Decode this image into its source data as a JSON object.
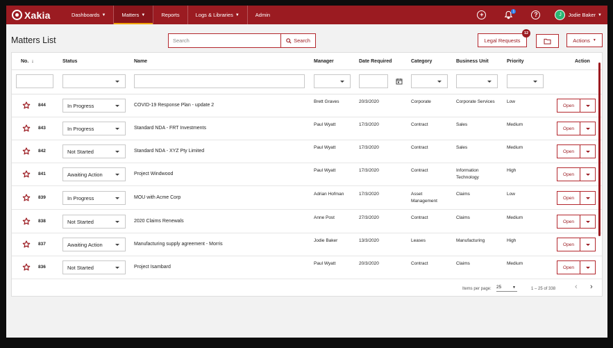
{
  "topbar": {
    "logo_text": "Xakia",
    "nav": [
      {
        "label": "Dashboards",
        "caret": true
      },
      {
        "label": "Matters",
        "caret": true,
        "active": true
      },
      {
        "label": "Reports",
        "caret": false
      },
      {
        "label": "Logs & Libraries",
        "caret": true
      },
      {
        "label": "Admin",
        "caret": false
      }
    ],
    "notification_count": "1",
    "user_initial": "J",
    "user_name": "Jodie Baker"
  },
  "header": {
    "title": "Matters List",
    "search_placeholder": "Search",
    "search_button": "Search",
    "legal_requests_label": "Legal Requests",
    "legal_requests_count": "12",
    "actions_label": "Actions"
  },
  "table": {
    "columns": {
      "no": "No.",
      "status": "Status",
      "name": "Name",
      "manager": "Manager",
      "date": "Date Required",
      "category": "Category",
      "unit": "Business Unit",
      "priority": "Priority",
      "action": "Action"
    },
    "open_label": "Open",
    "rows": [
      {
        "no": "844",
        "status": "In Progress",
        "name": "COVID-19 Response Plan - update 2",
        "manager": "Brett Graves",
        "date": "20/3/2020",
        "category": "Corporate",
        "unit": "Corporate Services",
        "priority": "Low"
      },
      {
        "no": "843",
        "status": "In Progress",
        "name": "Standard NDA - FRT Investments",
        "manager": "Paul Wyatt",
        "date": "17/3/2020",
        "category": "Contract",
        "unit": "Sales",
        "priority": "Medium"
      },
      {
        "no": "842",
        "status": "Not Started",
        "name": "Standard NDA - XYZ Pty Limited",
        "manager": "Paul Wyatt",
        "date": "17/3/2020",
        "category": "Contract",
        "unit": "Sales",
        "priority": "Medium"
      },
      {
        "no": "841",
        "status": "Awaiting Action",
        "name": "Project Windwood",
        "manager": "Paul Wyatt",
        "date": "17/3/2020",
        "category": "Contract",
        "unit": "Information Technology",
        "priority": "High"
      },
      {
        "no": "839",
        "status": "In Progress",
        "name": "MOU with Acme Corp",
        "manager": "Adrian Hofman",
        "date": "17/3/2020",
        "category": "Asset Management",
        "unit": "Claims",
        "priority": "Low"
      },
      {
        "no": "838",
        "status": "Not Started",
        "name": "2020 Claims Renewals",
        "manager": "Anne Post",
        "date": "27/3/2020",
        "category": "Contract",
        "unit": "Claims",
        "priority": "Medium"
      },
      {
        "no": "837",
        "status": "Awaiting Action",
        "name": "Manufacturing supply agreement - Morris",
        "manager": "Jodie Baker",
        "date": "13/3/2020",
        "category": "Leases",
        "unit": "Manufacturing",
        "priority": "High"
      },
      {
        "no": "836",
        "status": "Not Started",
        "name": "Project Isambard",
        "manager": "Paul Wyatt",
        "date": "20/3/2020",
        "category": "Contract",
        "unit": "Claims",
        "priority": "Medium"
      }
    ]
  },
  "pager": {
    "items_label": "Items per page:",
    "items_value": "25",
    "range": "1 – 25 of 338"
  }
}
